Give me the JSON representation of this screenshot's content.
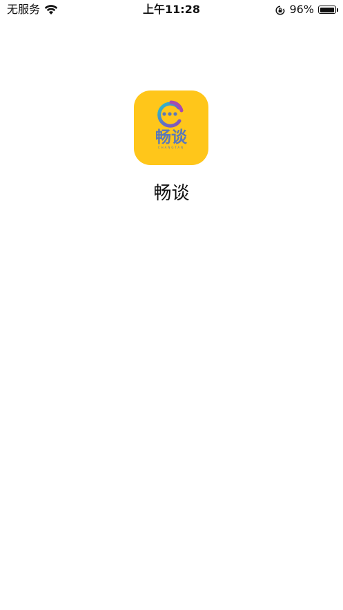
{
  "status_bar": {
    "carrier": "无服务",
    "time": "上午11:28",
    "battery_percent_label": "96%",
    "battery_level": 0.96,
    "icons": [
      "wifi-icon",
      "orientation-lock-icon",
      "battery-icon"
    ]
  },
  "app": {
    "name": "畅谈",
    "icon_text": "畅谈",
    "icon_subtext": "CHANGTAN",
    "icon_background": "#FFC61A",
    "icon_text_color": "#5C79B8"
  }
}
